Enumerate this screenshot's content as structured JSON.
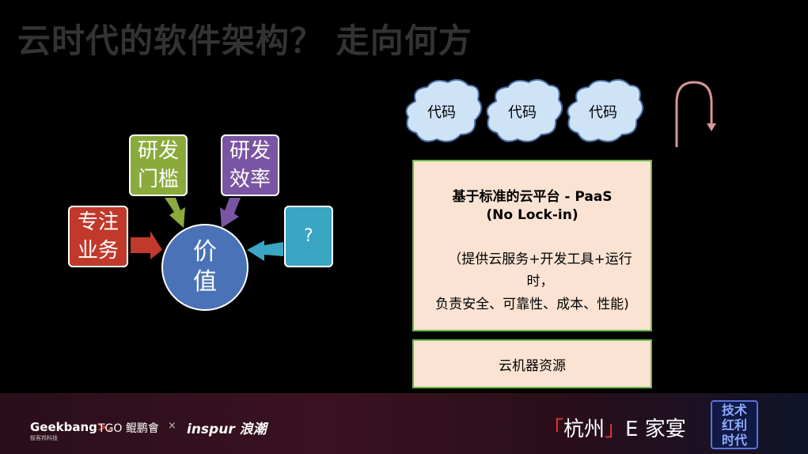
{
  "slide": {
    "title": "云时代的软件架构？ 走向何方",
    "boxes": {
      "red_line1": "专注",
      "red_line2": "业务",
      "green_line1": "研发",
      "green_line2": "门槛",
      "purple_line1": "研发",
      "purple_line2": "效率",
      "teal": "?"
    },
    "center_line1": "价",
    "center_line2": "值",
    "clouds": [
      "代码",
      "代码",
      "代码"
    ],
    "paas": {
      "title": "基于标准的云平台 - PaaS",
      "subtitle": "(No Lock-in)",
      "desc_line1": "（提供云服务+开发工具+运行时，",
      "desc_line2": "负责安全、可靠性、成本、性能)"
    },
    "infra": "云机器资源"
  },
  "footer": {
    "geek_logo_a": "Geek",
    "geek_logo_b": "bang",
    "geek_logo_c": ">.",
    "geek_sub": "极客邦科技",
    "tgo": "TGO 鲲鹏會",
    "cross": "×",
    "inspur": "inspur 浪潮",
    "event_open": "「",
    "event_city": "杭州",
    "event_close": "」",
    "event_name": "E 家宴",
    "badge": "技术红利时代"
  },
  "colors": {
    "red": "#c0392b",
    "green": "#8aab3c",
    "purple": "#7a55a3",
    "teal": "#3aa6c3",
    "center": "#4a72b7",
    "paas_fill": "#fbe3d3",
    "paas_border": "#6bb84a",
    "cloud": "#cfe3f7"
  }
}
